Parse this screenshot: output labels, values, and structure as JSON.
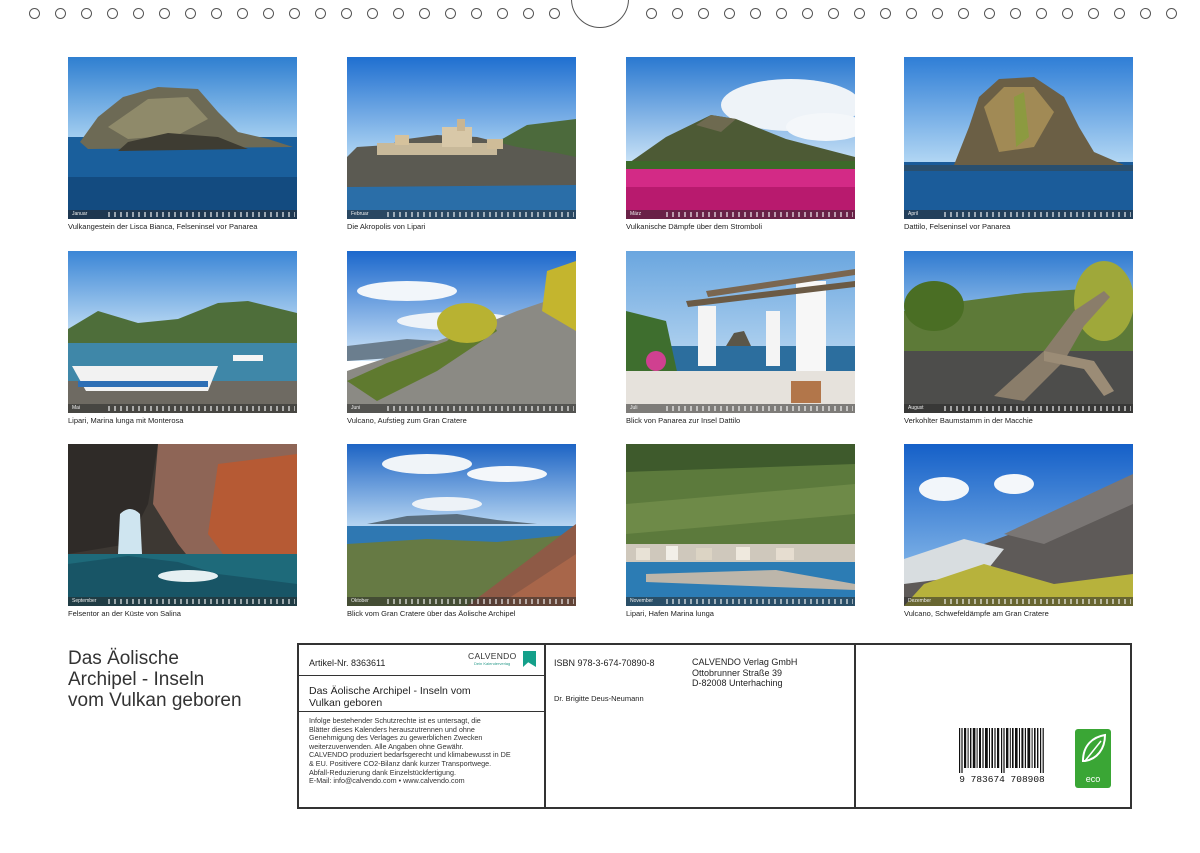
{
  "photos": [
    {
      "name": "lisca-bianca-photo",
      "month": "Januar",
      "caption": "Vulkangestein der Lisca Bianca, Felseninsel vor Panarea"
    },
    {
      "name": "lipari-akropolis-photo",
      "month": "Februar",
      "caption": "Die Akropolis von Lipari"
    },
    {
      "name": "stromboli-photo",
      "month": "März",
      "caption": "Vulkanische Dämpfe über dem Stromboli"
    },
    {
      "name": "dattilo-photo",
      "month": "April",
      "caption": "Dattilo, Felseninsel vor Panarea"
    },
    {
      "name": "marina-lunga-photo",
      "month": "Mai",
      "caption": "Lipari, Marina lunga mit Monterosa"
    },
    {
      "name": "gran-cratere-path-photo",
      "month": "Juni",
      "caption": "Vulcano, Aufstieg zum Gran Cratere"
    },
    {
      "name": "panarea-terrace-photo",
      "month": "Juli",
      "caption": "Blick von Panarea zur Insel Dattilo"
    },
    {
      "name": "tree-trunk-photo",
      "month": "August",
      "caption": "Verkohlter Baumstamm in der Macchie"
    },
    {
      "name": "salina-rock-photo",
      "month": "September",
      "caption": "Felsentor an der Küste von Salina"
    },
    {
      "name": "archipel-view-photo",
      "month": "Oktober",
      "caption": "Blick vom Gran Cratere über das Äolische Archipel"
    },
    {
      "name": "lipari-harbour-photo",
      "month": "November",
      "caption": "Lipari, Hafen Marina lunga"
    },
    {
      "name": "sulphur-fumes-photo",
      "month": "Dezember",
      "caption": "Vulcano, Schwefeldämpfe am Gran Cratere"
    }
  ],
  "title_lines": [
    "Das Äolische",
    "Archipel - Inseln",
    "vom Vulkan geboren"
  ],
  "panel": {
    "article_no": "Artikel-Nr. 8363611",
    "logo_text": "CALVENDO",
    "logo_sub": "Dein Kalenderverlag",
    "subtitle_lines": [
      "Das Äolische Archipel - Inseln vom",
      "Vulkan geboren"
    ],
    "legal_lines": [
      "Infolge bestehender Schutzrechte ist es untersagt, die",
      "Blätter dieses Kalenders herauszutrennen und ohne",
      "Genehmigung des Verlages zu gewerblichen Zwecken",
      "weiterzuverwenden. Alle Angaben ohne Gewähr.",
      "CALVENDO produziert bedarfsgerecht und klimabewusst in DE",
      "& EU. Positivere CO2-Bilanz dank kurzer Transportwege.",
      "Abfall-Reduzierung dank Einzelstückfertigung.",
      "E-Mail: info@calvendo.com • www.calvendo.com"
    ],
    "isbn": "ISBN 978-3-674-70890-8",
    "author": "Dr. Brigitte Deus-Neumann",
    "publisher_lines": [
      "CALVENDO Verlag GmbH",
      "Ottobrunner Straße 39",
      "D-82008 Unterhaching"
    ],
    "barcode_number": "9 783674 708908",
    "eco_label": "eco"
  },
  "colors": {
    "frame": "#333333",
    "eco_green": "#3aa635",
    "brand_teal": "#14a08a"
  }
}
